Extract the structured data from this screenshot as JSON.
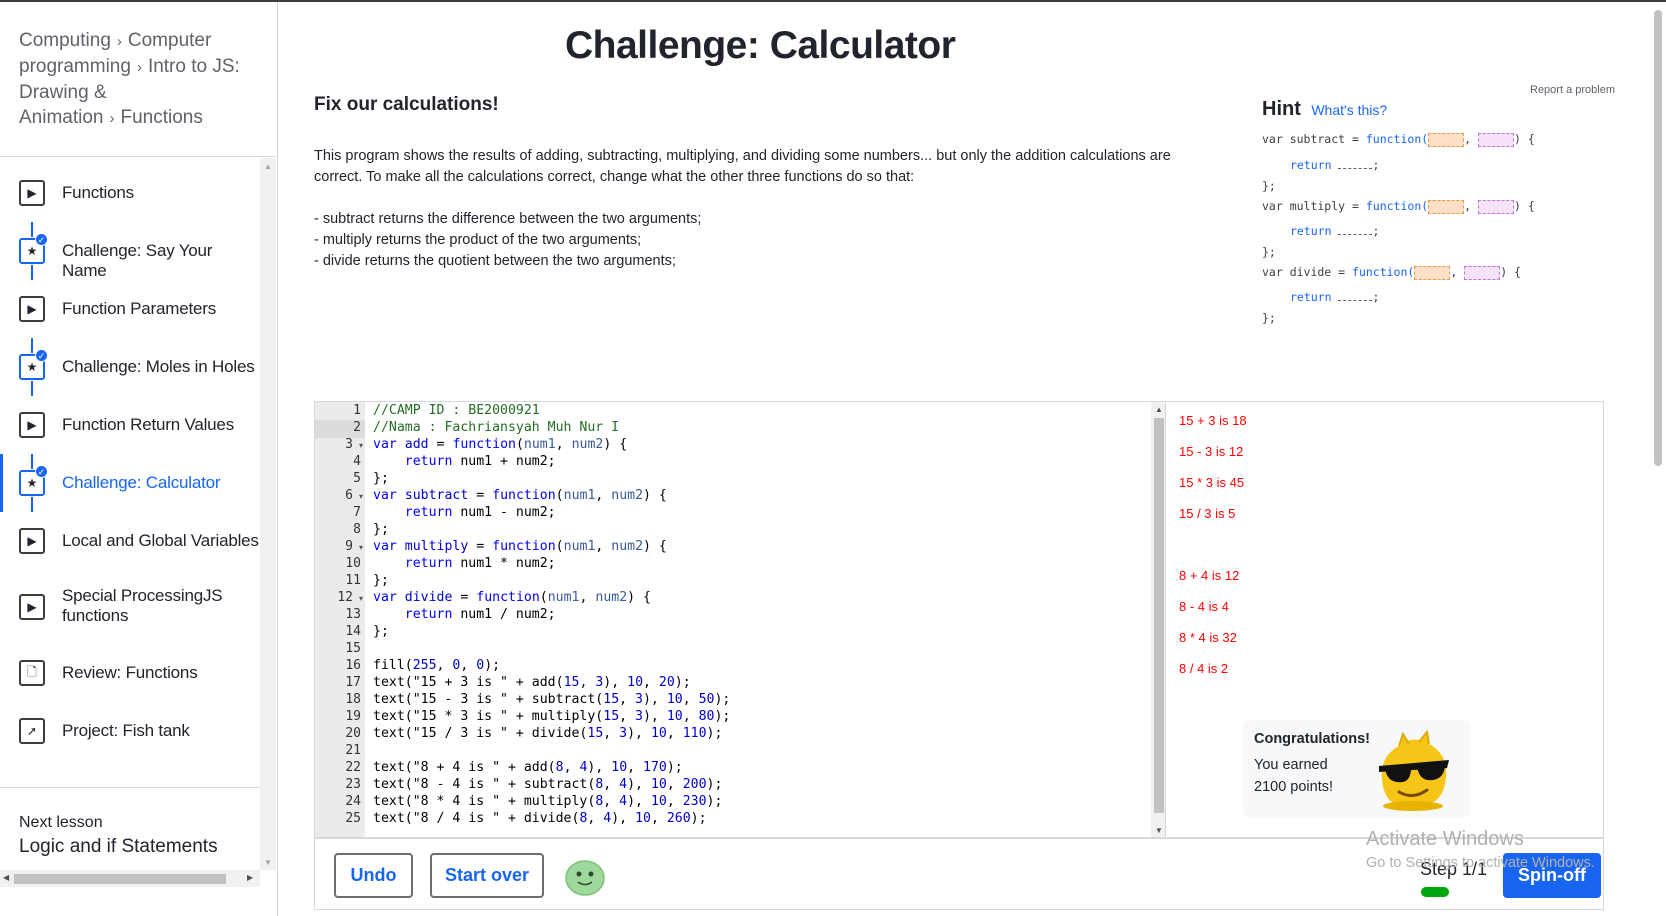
{
  "breadcrumb": [
    "Computing",
    "Computer programming",
    "Intro to JS: Drawing & Animation",
    "Functions"
  ],
  "breadcrumb_sep": "›",
  "lessons": [
    {
      "label": "Functions",
      "icon": "play-icon",
      "done": false,
      "active": false
    },
    {
      "label": "Challenge: Say Your Name",
      "icon": "star-icon",
      "done": true,
      "active": false
    },
    {
      "label": "Function Parameters",
      "icon": "play-icon",
      "done": false,
      "active": false
    },
    {
      "label": "Challenge: Moles in Holes",
      "icon": "star-icon",
      "done": true,
      "active": false
    },
    {
      "label": "Function Return Values",
      "icon": "play-icon",
      "done": false,
      "active": false
    },
    {
      "label": "Challenge: Calculator",
      "icon": "star-icon",
      "done": true,
      "active": true
    },
    {
      "label": "Local and Global Variables",
      "icon": "play-icon",
      "done": false,
      "active": false
    },
    {
      "label": "Special ProcessingJS functions",
      "icon": "play-icon",
      "done": false,
      "active": false
    },
    {
      "label": "Review: Functions",
      "icon": "document-icon",
      "done": false,
      "active": false
    },
    {
      "label": "Project: Fish tank",
      "icon": "rocket-icon",
      "done": false,
      "active": false
    }
  ],
  "next_lesson": {
    "kicker": "Next lesson",
    "title": "Logic and if Statements"
  },
  "title": "Challenge: Calculator",
  "subtitle": "Fix our calculations!",
  "report": "Report a problem",
  "description": {
    "intro": "This program shows the results of adding, subtracting, multiplying, and dividing some numbers... but only the addition calculations are correct. To make all the calculations correct, change what the other three functions do so that:",
    "bullets": [
      "- subtract returns the difference between the two arguments;",
      "- multiply returns the product of the two arguments;",
      "- divide returns the quotient between the two arguments;"
    ]
  },
  "hint": {
    "title": "Hint",
    "whats_this": "What's this?",
    "lines": [
      {
        "name": "var subtract = ",
        "kw": "function("
      },
      {
        "name": "var multiply = ",
        "kw": "function("
      },
      {
        "name": "var divide = ",
        "kw": "function("
      }
    ],
    "return_kw": "return",
    "close": "};",
    "open_brace": ") {",
    "comma": ","
  },
  "editor": {
    "line_numbers": [
      "1",
      "2",
      "3",
      "4",
      "5",
      "6",
      "7",
      "8",
      "9",
      "10",
      "11",
      "12",
      "13",
      "14",
      "15",
      "16",
      "17",
      "18",
      "19",
      "20",
      "21",
      "22",
      "23",
      "24",
      "25"
    ],
    "active_line": 2
  },
  "output_lines": [
    "15 + 3 is 18",
    "15 - 3 is 12",
    "15 * 3 is 45",
    "15 / 3 is 5",
    "8 + 4 is 12",
    "8 - 4 is 4",
    "8 * 4 is 32",
    "8 / 4 is 2"
  ],
  "congrats": {
    "title": "Congratulations!",
    "body": "You earned 2100 points!"
  },
  "buttons": {
    "undo": "Undo",
    "start_over": "Start over",
    "spin_off": "Spin-off"
  },
  "step": "Step 1/1",
  "watermark": {
    "line1": "Activate Windows",
    "line2": "Go to Settings to activate Windows."
  },
  "colors": {
    "accent": "#1865f2",
    "output_text": "#ff0000",
    "progress": "#00a60e"
  }
}
